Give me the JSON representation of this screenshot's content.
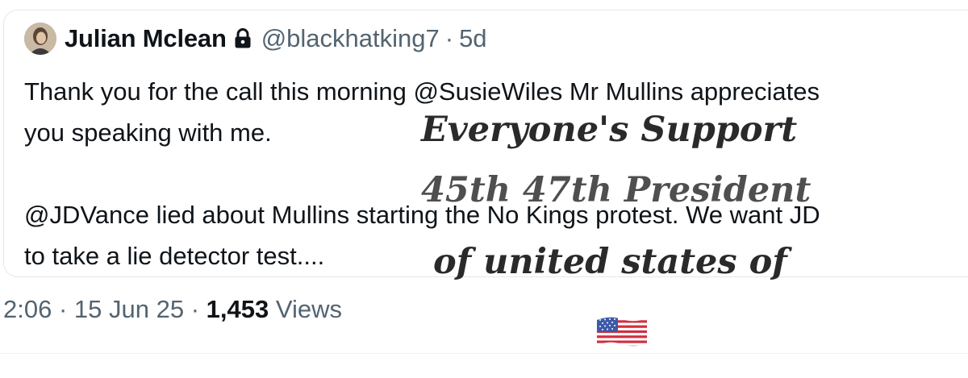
{
  "quoted_tweet": {
    "author_name": "Julian Mclean",
    "author_handle": "@blackhatking7",
    "separator": "·",
    "age": "5d",
    "lock_icon": "lock-icon",
    "text_lines": [
      "Thank you for the call this morning @SusieWiles Mr Mullins appreciates",
      "you speaking with me.",
      "",
      "@JDVance lied about Mullins starting the No Kings protest. We want JD",
      "to take a lie detector test...."
    ]
  },
  "tweet_meta": {
    "time": "2:06",
    "separator": "·",
    "date": "15 Jun 25",
    "views_count": "1,453",
    "views_label": "Views"
  },
  "overlay": {
    "lines": [
      "Everyone's Support",
      "45th 47th President",
      "of united states of"
    ],
    "flag_icon": "us-flag-icon"
  },
  "colors": {
    "primary_text": "#0f1419",
    "secondary_text": "#536471",
    "card_border": "#e3e7ea",
    "overlay_text": "#2a2a2a"
  }
}
